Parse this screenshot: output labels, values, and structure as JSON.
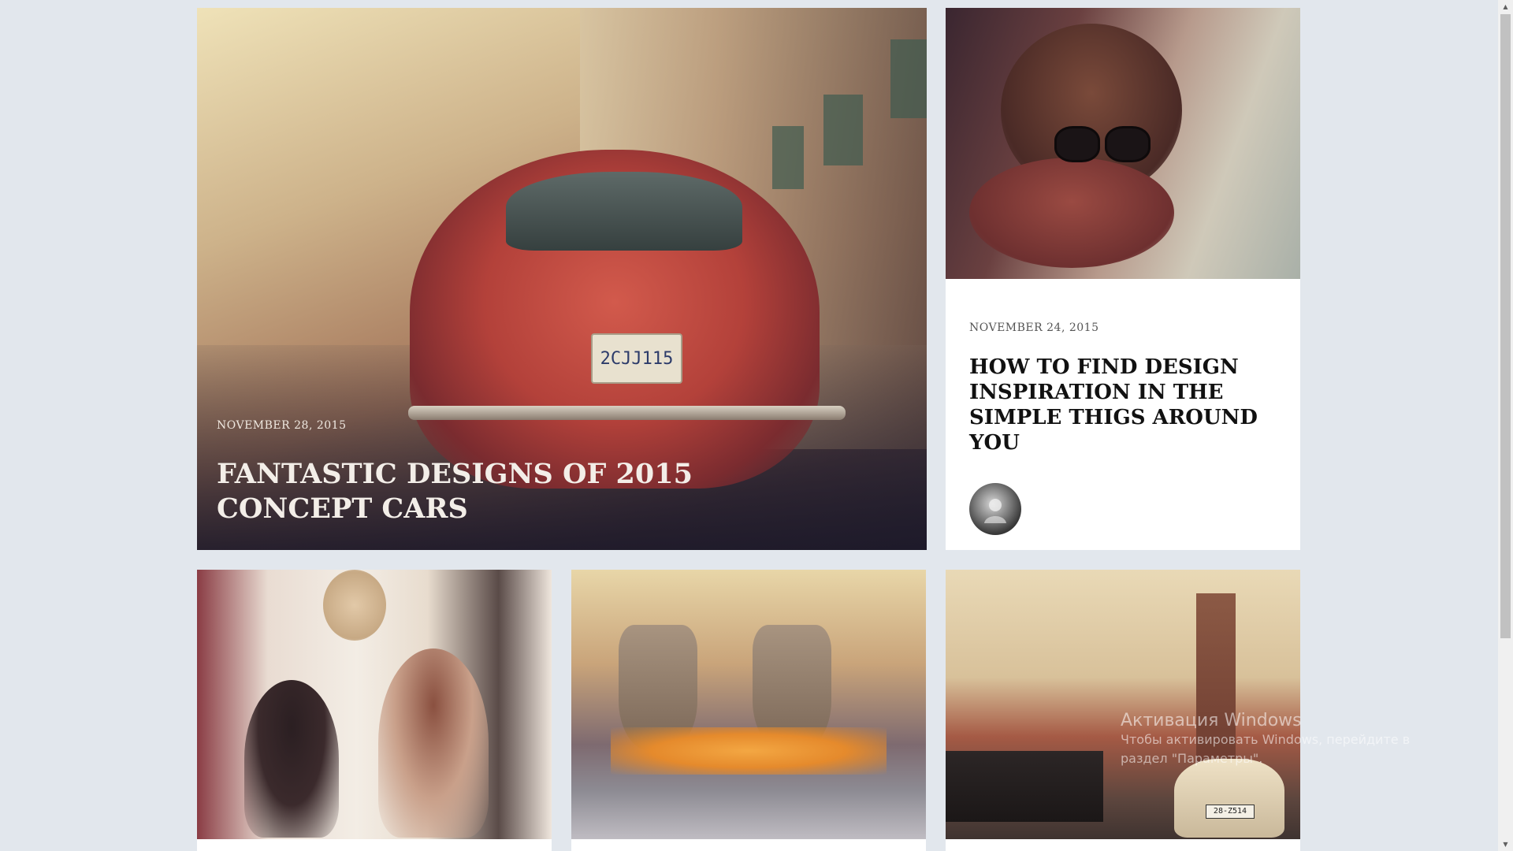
{
  "featured": {
    "date": "NOVEMBER 28, 2015",
    "title": "FANTASTIC DESIGNS OF 2015 CONCEPT CARS",
    "plate": "2CJJ115"
  },
  "side": {
    "date": "NOVEMBER 24, 2015",
    "title": "HOW TO FIND DESIGN INSPIRATION IN THE SIMPLE THIGS AROUND YOU"
  },
  "bottom_cards": [
    {
      "plate": ""
    },
    {
      "plate": ""
    },
    {
      "plate": "28-Z514"
    }
  ],
  "watermark": {
    "title": "Активация Windows",
    "subtitle": "Чтобы активировать Windows, перейдите в раздел \"Параметры\"."
  },
  "scrollbar": {
    "up_icon": "triangle-up-icon",
    "down_icon": "triangle-down-icon"
  }
}
